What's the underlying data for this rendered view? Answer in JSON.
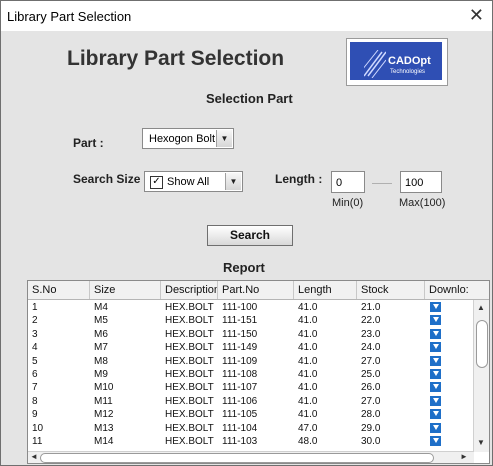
{
  "window": {
    "title": "Library Part Selection",
    "close_glyph": "✕"
  },
  "header": {
    "title": "Library Part Selection"
  },
  "logo": {
    "brand": "CADOpt",
    "sub": "Technologies"
  },
  "selection": {
    "section_title": "Selection Part",
    "part_label": "Part :",
    "part_value": "Hexogon Bolt",
    "search_size_label": "Search Size :",
    "search_size_value": "Show All",
    "show_all_checked": true,
    "length_label": "Length :",
    "length_min": "0",
    "length_max": "100",
    "min_label": "Min(0)",
    "max_label": "Max(100)",
    "search_button": "Search"
  },
  "report": {
    "title": "Report",
    "columns": [
      "S.No",
      "Size",
      "Description",
      "Part.No",
      "Length",
      "Stock",
      "Downlo:"
    ],
    "rows": [
      [
        "1",
        "M4",
        "HEX.BOLT",
        "111-100",
        "41.0",
        "21.0"
      ],
      [
        "2",
        "M5",
        "HEX.BOLT",
        "111-151",
        "41.0",
        "22.0"
      ],
      [
        "3",
        "M6",
        "HEX.BOLT",
        "111-150",
        "41.0",
        "23.0"
      ],
      [
        "4",
        "M7",
        "HEX.BOLT",
        "111-149",
        "41.0",
        "24.0"
      ],
      [
        "5",
        "M8",
        "HEX.BOLT",
        "111-109",
        "41.0",
        "27.0"
      ],
      [
        "6",
        "M9",
        "HEX.BOLT",
        "111-108",
        "41.0",
        "25.0"
      ],
      [
        "7",
        "M10",
        "HEX.BOLT",
        "111-107",
        "41.0",
        "26.0"
      ],
      [
        "8",
        "M11",
        "HEX.BOLT",
        "111-106",
        "41.0",
        "27.0"
      ],
      [
        "9",
        "M12",
        "HEX.BOLT",
        "111-105",
        "41.0",
        "28.0"
      ],
      [
        "10",
        "M13",
        "HEX.BOLT",
        "111-104",
        "47.0",
        "29.0"
      ],
      [
        "11",
        "M14",
        "HEX.BOLT",
        "111-103",
        "48.0",
        "30.0"
      ]
    ]
  },
  "colors": {
    "download_icon": "#1e6fc8",
    "logo_bg": "#2f4fb4"
  }
}
